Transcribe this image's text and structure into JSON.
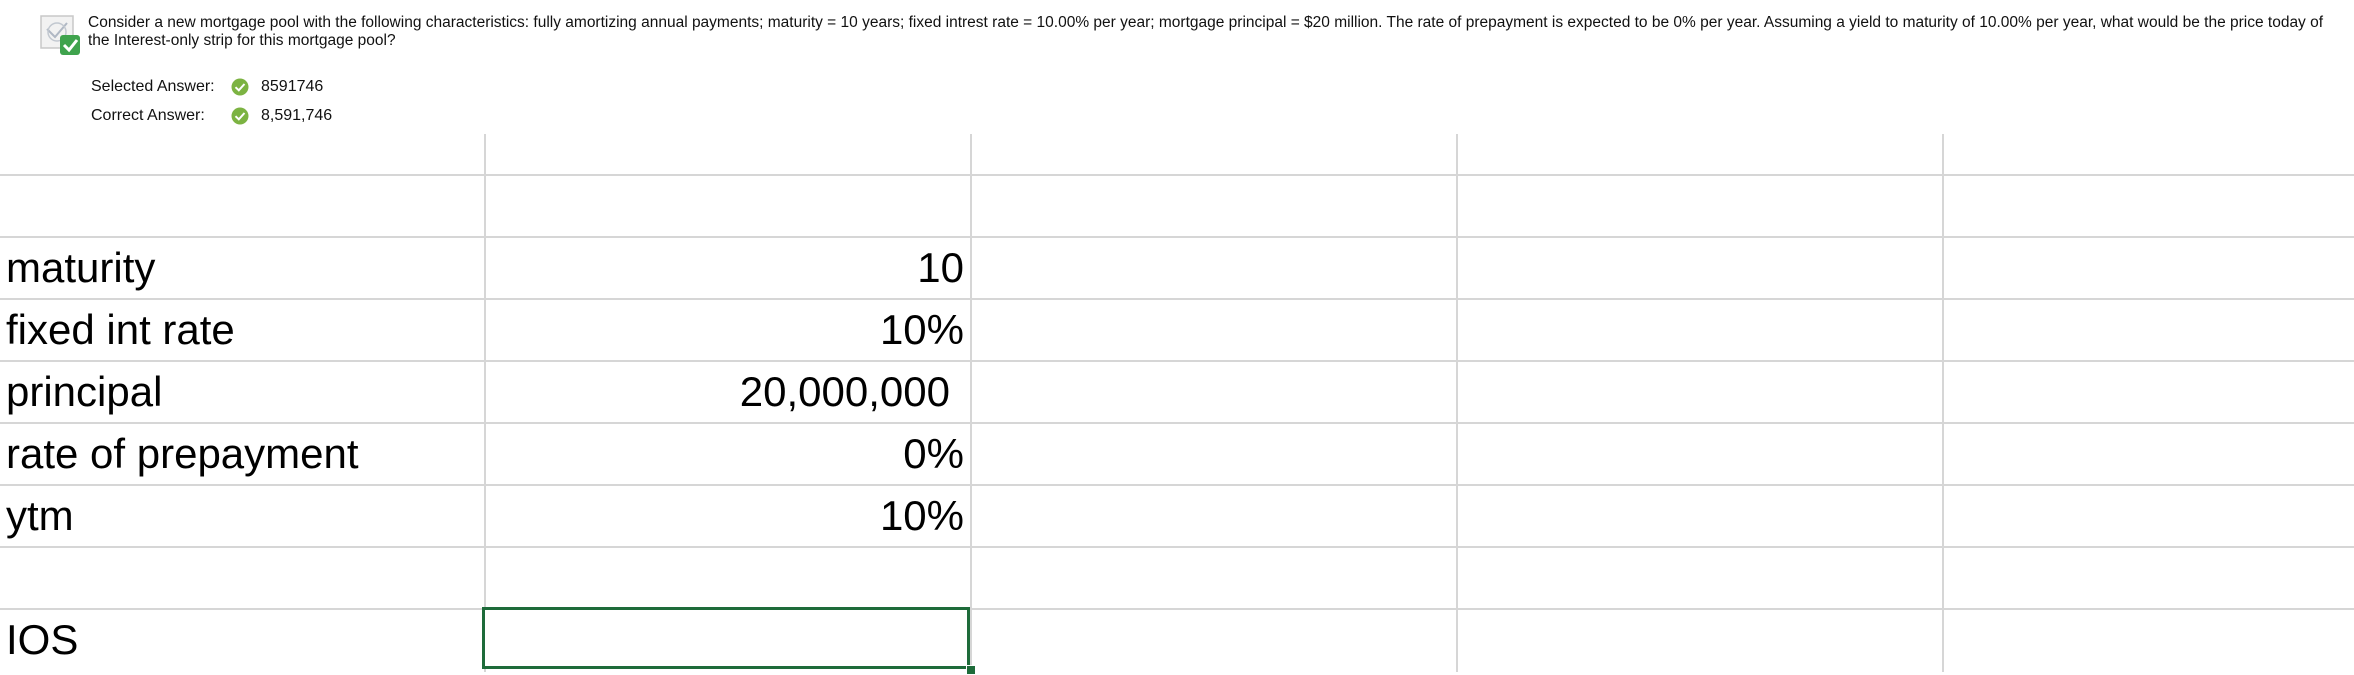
{
  "question": {
    "text": "Consider a new mortgage pool with the following characteristics: fully amortizing annual payments; maturity = 10 years; fixed intrest rate = 10.00% per year; mortgage principal = $20 million. The rate of prepayment is expected to be 0% per year. Assuming a yield to maturity of 10.00% per year, what would be the price today of the Interest-only strip for this mortgage pool?",
    "icon": "question-correct-icon"
  },
  "answers": {
    "selected_label": "Selected Answer:",
    "selected_value": "8591746",
    "correct_label": "Correct Answer:",
    "correct_value": "8,591,746",
    "check_icon": "green-check-icon",
    "check_color": "#7cb342"
  },
  "spreadsheet": {
    "rows": [
      {
        "label": "maturity",
        "value": "10"
      },
      {
        "label": "fixed int rate",
        "value": "10%"
      },
      {
        "label": "principal",
        "value": "20,000,000 "
      },
      {
        "label": "rate of prepayment",
        "value": "0%"
      },
      {
        "label": "ytm",
        "value": "10%"
      }
    ],
    "ios_label": "IOS",
    "ios_value": "",
    "selection_color": "#1e6b3a",
    "grid_color": "#d6d6d6"
  }
}
